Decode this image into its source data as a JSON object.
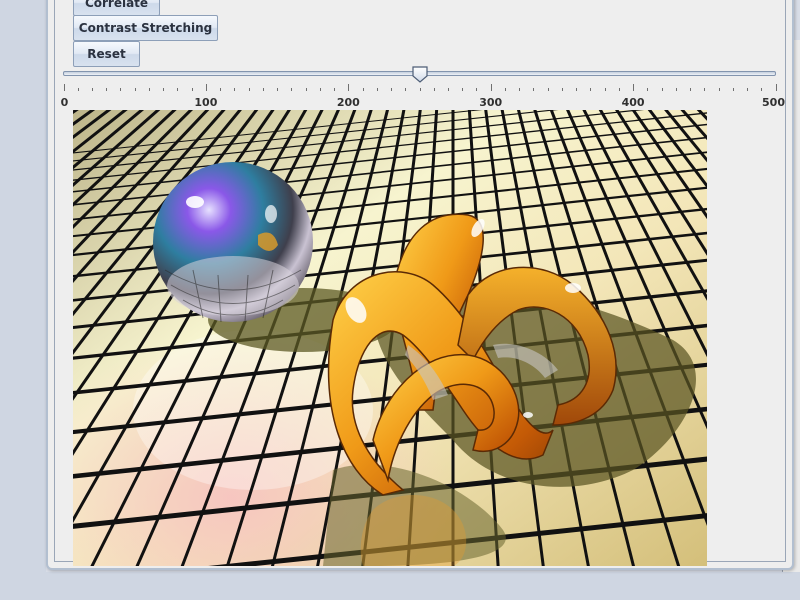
{
  "buttons": {
    "correlate": "Correlate",
    "contrast_stretching": "Contrast Stretching",
    "reset": "Reset"
  },
  "slider": {
    "min": 0,
    "max": 500,
    "value": 250,
    "major_labels": [
      "0",
      "100",
      "200",
      "300",
      "400",
      "500"
    ]
  },
  "image": {
    "description_icon": "raytraced-scene-image"
  },
  "colors": {
    "window_bg": "#eeeeee",
    "button_text": "#2b3240",
    "accent_border": "#8d9fb8"
  }
}
